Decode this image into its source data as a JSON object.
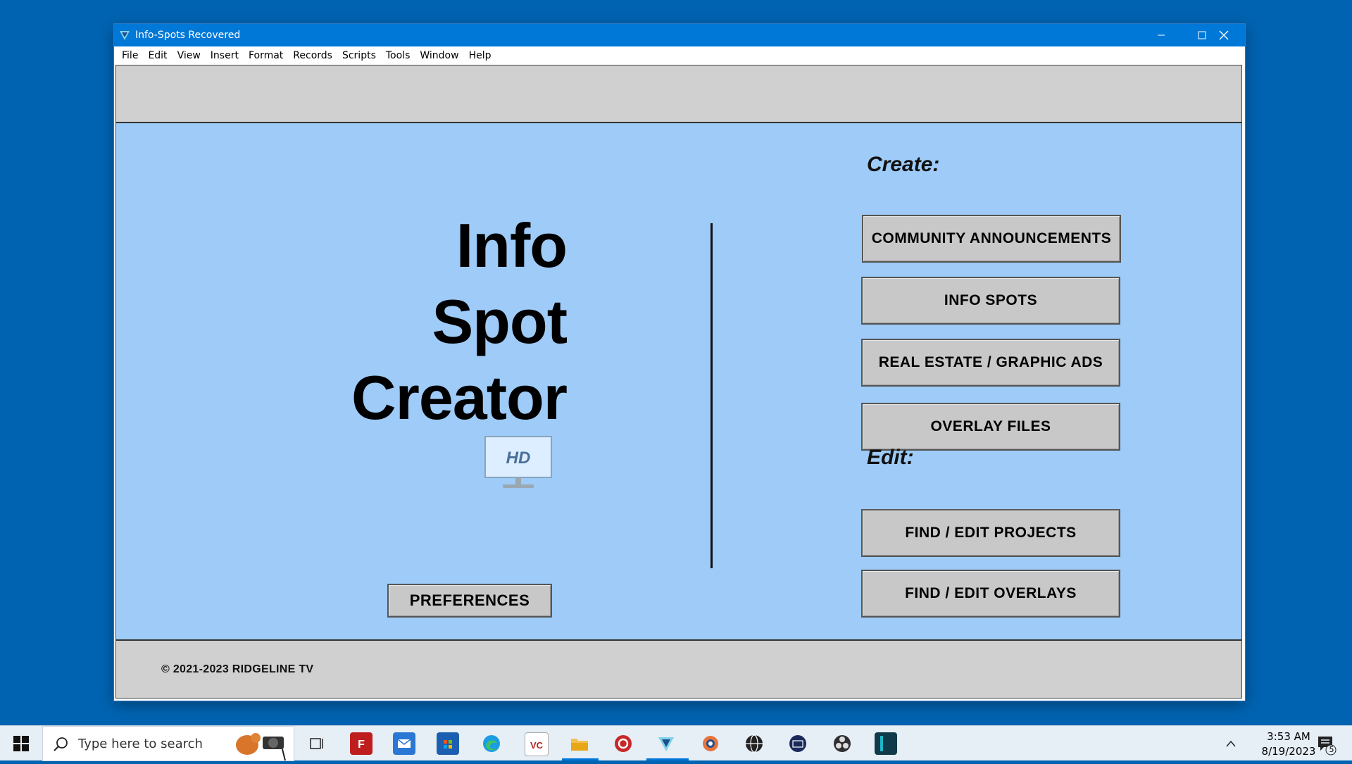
{
  "window": {
    "title": "Info-Spots Recovered",
    "controls": {
      "minimize": "minimize",
      "maximize": "maximize",
      "close": "close"
    }
  },
  "menu": {
    "items": [
      {
        "label": "File"
      },
      {
        "label": "Edit"
      },
      {
        "label": "View"
      },
      {
        "label": "Insert"
      },
      {
        "label": "Format"
      },
      {
        "label": "Records"
      },
      {
        "label": "Scripts"
      },
      {
        "label": "Tools"
      },
      {
        "label": "Window"
      },
      {
        "label": "Help"
      }
    ]
  },
  "main": {
    "title_lines": [
      "Info",
      "Spot",
      "Creator"
    ],
    "hd_badge": "HD",
    "preferences_label": "PREFERENCES",
    "create_label": "Create:",
    "edit_label": "Edit:",
    "create_buttons": [
      {
        "label": "COMMUNITY ANNOUNCEMENTS"
      },
      {
        "label": "INFO SPOTS"
      },
      {
        "label": "REAL ESTATE / GRAPHIC ADS"
      },
      {
        "label": "OVERLAY FILES"
      }
    ],
    "edit_buttons": [
      {
        "label": "FIND / EDIT PROJECTS"
      },
      {
        "label": "FIND / EDIT OVERLAYS"
      }
    ],
    "copyright": "©  2021-2023 RIDGELINE TV"
  },
  "taskbar": {
    "search_placeholder": "Type here to search",
    "pinned_icons": [
      "task-view-icon",
      "filezilla-icon",
      "mail-icon",
      "store-icon",
      "edge-icon",
      "vc-icon",
      "file-explorer-icon",
      "red-app-icon",
      "filemaker-icon",
      "gear-app-icon",
      "globe-app-icon",
      "keyboard-app-icon",
      "obs-icon",
      "dark-app-icon"
    ],
    "time": "3:53 AM",
    "date": "8/19/2023",
    "notification_count": "5"
  },
  "colors": {
    "desktop": "#0063b1",
    "titlebar": "#0078d7",
    "content_bg": "#9ecbf7",
    "panel_bg": "#d0d0d0",
    "button_bg": "#c8c8c8"
  }
}
